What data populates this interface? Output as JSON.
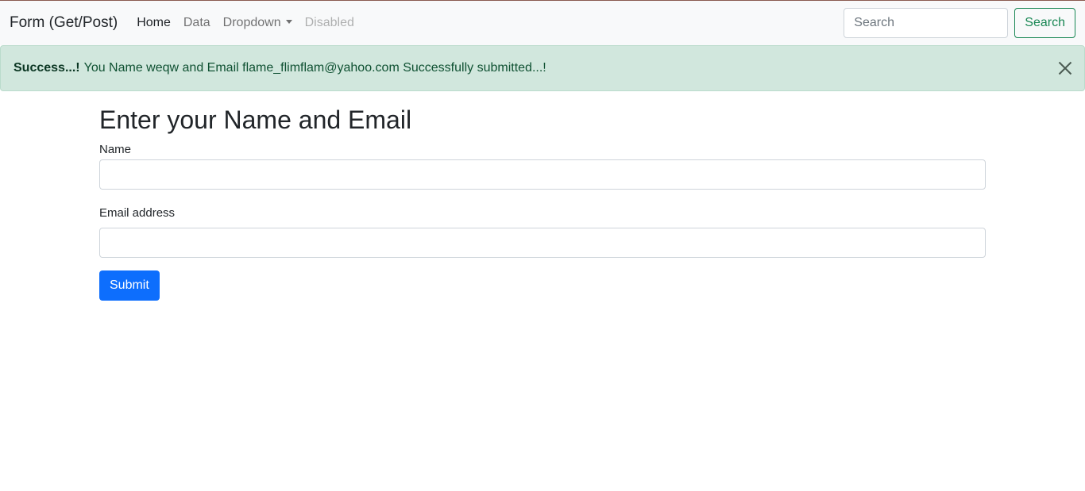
{
  "navbar": {
    "brand": "Form (Get/Post)",
    "links": [
      {
        "label": "Home"
      },
      {
        "label": "Data"
      },
      {
        "label": "Dropdown"
      },
      {
        "label": "Disabled"
      }
    ],
    "search_placeholder": "Search",
    "search_button": "Search"
  },
  "alert": {
    "strong": "Success...!",
    "message": "You Name weqw and Email flame_flimflam@yahoo.com Successfully submitted...!"
  },
  "form": {
    "title": "Enter your Name and Email",
    "name_label": "Name",
    "name_value": "",
    "email_label": "Email address",
    "email_value": "",
    "submit": "Submit"
  }
}
